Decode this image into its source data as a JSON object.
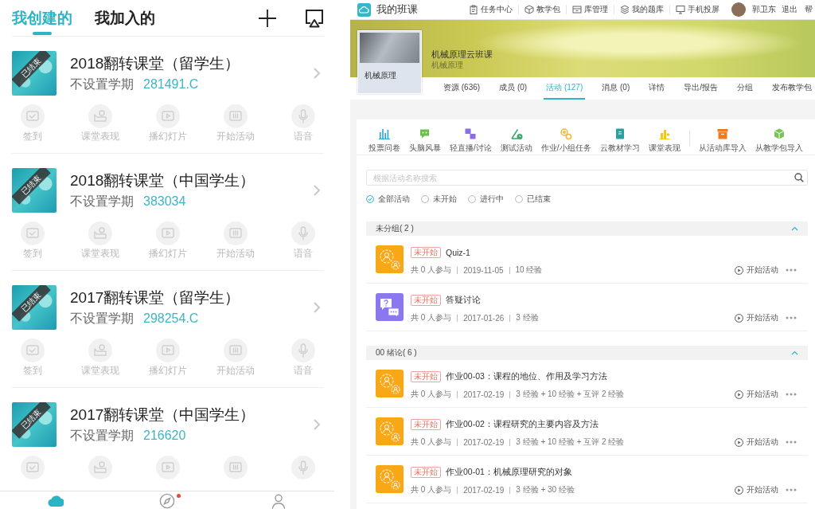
{
  "class_app": {
    "tabs": [
      {
        "label": "我创建的",
        "selected": true
      },
      {
        "label": "我加入的",
        "selected": false
      }
    ],
    "classes": [
      {
        "title": "2018翻转课堂（留学生）",
        "status": "已结束",
        "term": "不设置学期",
        "code": "281491.C",
        "actions": [
          "签到",
          "课堂表现",
          "播幻灯片",
          "开始活动",
          "语音"
        ]
      },
      {
        "title": "2018翻转课堂（中国学生）",
        "status": "已结束",
        "term": "不设置学期",
        "code": "383034",
        "actions": [
          "签到",
          "课堂表现",
          "播幻灯片",
          "开始活动",
          "语音"
        ]
      },
      {
        "title": "2017翻转课堂（留学生）",
        "status": "已结束",
        "term": "不设置学期",
        "code": "298254.C",
        "actions": [
          "签到",
          "课堂表现",
          "播幻灯片",
          "开始活动",
          "语音"
        ]
      },
      {
        "title": "2017翻转课堂（中国学生）",
        "status": "已结束",
        "term": "不设置学期",
        "code": "216620"
      }
    ],
    "bottom_nav": [
      {
        "selected": true,
        "badge": false
      },
      {
        "selected": false,
        "badge": true
      },
      {
        "selected": false,
        "badge": false
      }
    ]
  },
  "web": {
    "app_title": "我的班课",
    "nav": [
      "任务中心",
      "教学包",
      "库管理",
      "我的题库",
      "手机投屏"
    ],
    "user_name": "郭卫东",
    "logout": "退出",
    "help": "帮",
    "course": {
      "card_title": "机械原理",
      "title": "机械原理云班课",
      "subtitle": "机械原理"
    },
    "tabs": [
      {
        "label": "资源 (636)",
        "selected": false
      },
      {
        "label": "成员 (0)",
        "selected": false
      },
      {
        "label": "活动 (127)",
        "selected": true
      },
      {
        "label": "消息 (0)",
        "selected": false
      },
      {
        "label": "详情",
        "selected": false
      },
      {
        "label": "导出/报告",
        "selected": false
      },
      {
        "label": "分组",
        "selected": false
      },
      {
        "label": "发布教学包",
        "selected": false
      }
    ],
    "tools": [
      "投票问卷",
      "头脑风暴",
      "轻直播/讨论",
      "测试活动",
      "作业/小组任务",
      "云教材学习",
      "课堂表现"
    ],
    "import_tools": [
      "从活动库导入",
      "从教学包导入"
    ],
    "search": {
      "placeholder": "根据活动名称搜索"
    },
    "filters": [
      {
        "label": "全部活动",
        "selected": true
      },
      {
        "label": "未开始",
        "selected": false
      },
      {
        "label": "进行中",
        "selected": false
      },
      {
        "label": "已结束",
        "selected": false
      }
    ],
    "groups": [
      {
        "title": "未分组( 2 )",
        "expanded": true,
        "activities": [
          {
            "kind": "homework",
            "status": "未开始",
            "title": "Quiz-1",
            "meta": [
              "共 0 人参与",
              "2019-11-05",
              "10 经验"
            ],
            "action": "开始活动"
          },
          {
            "kind": "discussion",
            "status": "未开始",
            "title": "答疑讨论",
            "meta": [
              "共 0 人参与",
              "2017-01-26",
              "3 经验"
            ],
            "action": "开始活动"
          }
        ]
      },
      {
        "title": "00 绪论( 6 )",
        "expanded": true,
        "activities": [
          {
            "kind": "homework",
            "status": "未开始",
            "title": "作业00-03：课程的地位、作用及学习方法",
            "meta": [
              "共 0 人参与",
              "2017-02-19",
              "3 经验 + 10 经验 + 互评 2 经验"
            ],
            "action": "开始活动"
          },
          {
            "kind": "homework",
            "status": "未开始",
            "title": "作业00-02：课程研究的主要内容及方法",
            "meta": [
              "共 0 人参与",
              "2017-02-19",
              "3 经验 + 10 经验 + 互评 2 经验"
            ],
            "action": "开始活动"
          },
          {
            "kind": "homework",
            "status": "未开始",
            "title": "作业00-01：机械原理研究的对象",
            "meta": [
              "共 0 人参与",
              "2017-02-19",
              "3 经验 + 30 经验"
            ],
            "action": "开始活动"
          }
        ]
      }
    ]
  }
}
